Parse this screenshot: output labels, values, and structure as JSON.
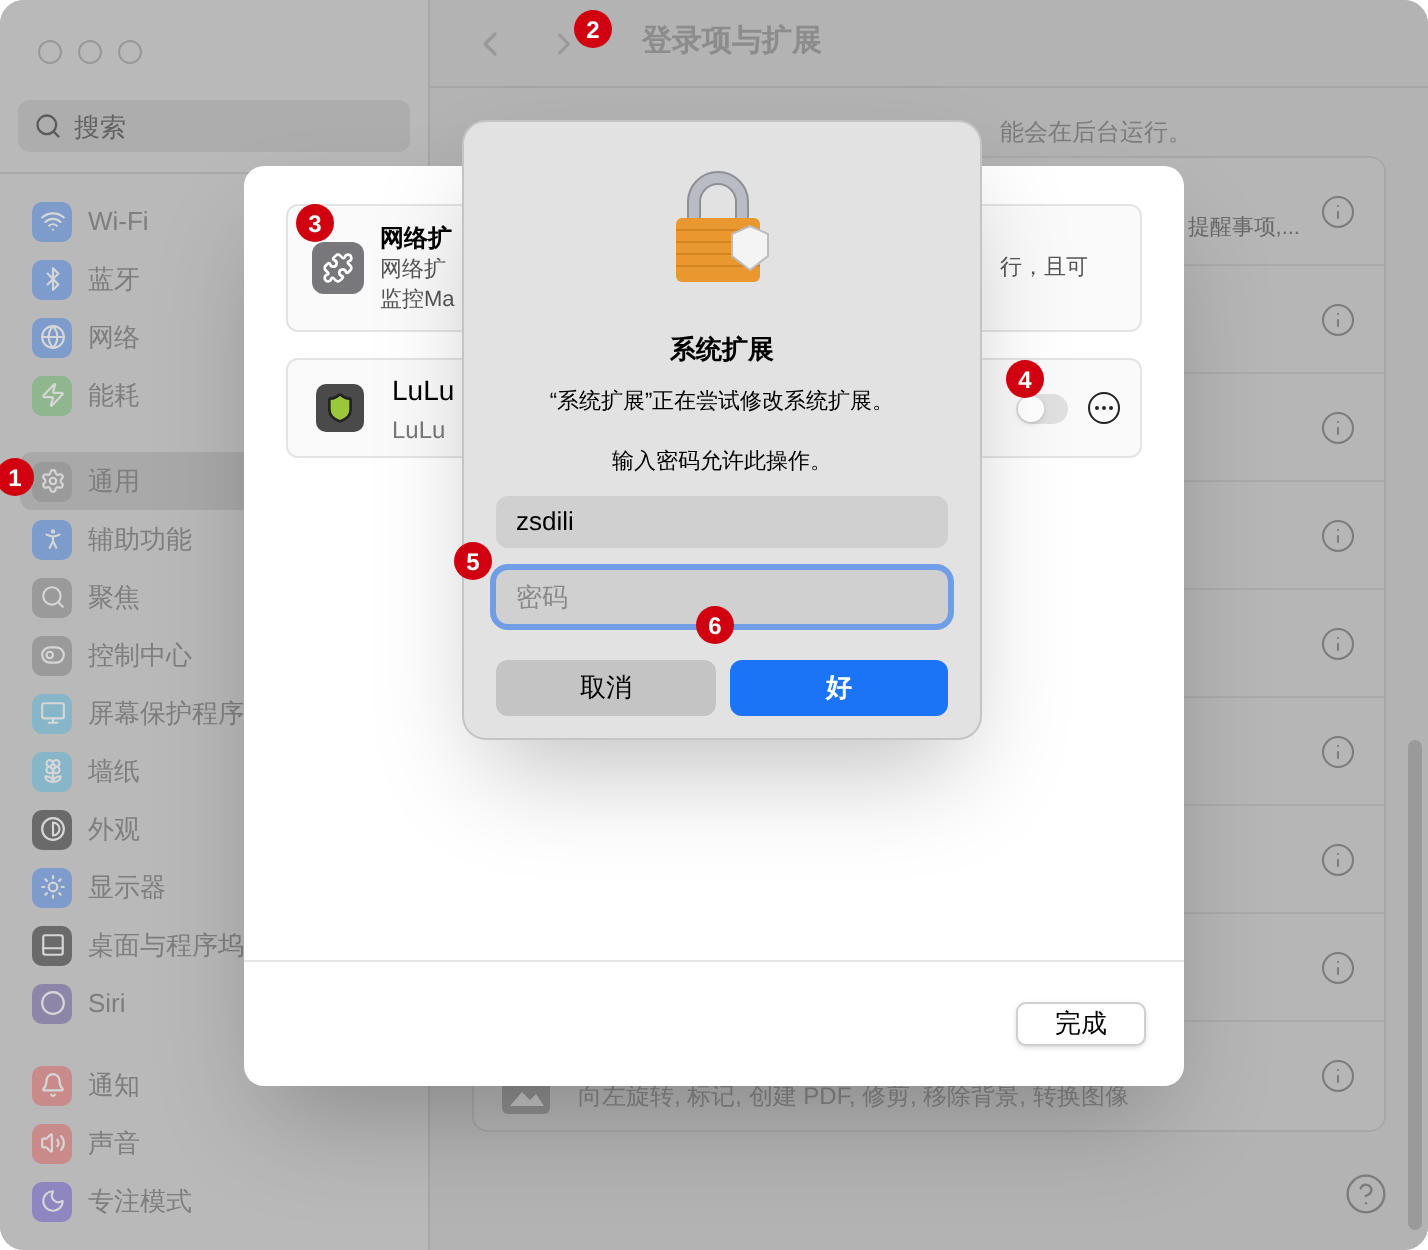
{
  "sidebar": {
    "search": {
      "placeholder": "搜索"
    },
    "groups": [
      [
        {
          "label": "Wi-Fi",
          "color": "#7d9ccb",
          "selected": false
        },
        {
          "label": "蓝牙",
          "color": "#7d9ccb",
          "selected": false
        },
        {
          "label": "网络",
          "color": "#7d9ccb",
          "selected": false
        },
        {
          "label": "能耗",
          "color": "#8fb68c",
          "selected": false
        }
      ],
      [
        {
          "label": "通用",
          "color": "#9a9a9a",
          "selected": true
        },
        {
          "label": "辅助功能",
          "color": "#7d9ccb",
          "selected": false
        },
        {
          "label": "聚焦",
          "color": "#9a9a9a",
          "selected": false
        },
        {
          "label": "控制中心",
          "color": "#9a9a9a",
          "selected": false
        },
        {
          "label": "屏幕保护程序",
          "color": "#86b6c8",
          "selected": false
        },
        {
          "label": "墙纸",
          "color": "#86b6c8",
          "selected": false
        },
        {
          "label": "外观",
          "color": "#6a6a6a",
          "selected": false
        },
        {
          "label": "显示器",
          "color": "#7d9ccb",
          "selected": false
        },
        {
          "label": "桌面与程序坞",
          "color": "#6a6a6a",
          "selected": false
        },
        {
          "label": "Siri",
          "color": "#8e86a8",
          "selected": false
        }
      ],
      [
        {
          "label": "通知",
          "color": "#c98a8a",
          "selected": false
        },
        {
          "label": "声音",
          "color": "#c98a8a",
          "selected": false
        },
        {
          "label": "专注模式",
          "color": "#8e86c0",
          "selected": false
        }
      ]
    ]
  },
  "header": {
    "title": "登录项与扩展"
  },
  "content": {
    "description": "能会在后台运行。",
    "rows": [
      {
        "kind": "text",
        "text": "提醒事项,..."
      },
      {
        "kind": "blank"
      },
      {
        "kind": "blank"
      },
      {
        "kind": "blank"
      },
      {
        "kind": "blank"
      },
      {
        "kind": "blank"
      },
      {
        "kind": "blank"
      },
      {
        "kind": "blank"
      },
      {
        "kind": "app",
        "text": "向左旋转, 标记, 创建 PDF, 修剪, 移除背景, 转换图像"
      }
    ]
  },
  "sheet": {
    "extensions": [
      {
        "kind": "network",
        "title": "网络扩",
        "lines": [
          "网络扩",
          "监控Ma"
        ],
        "trailing": "行，且可"
      },
      {
        "kind": "app",
        "title": "LuLu",
        "subtitle": "LuLu",
        "on": false
      }
    ],
    "done": "完成"
  },
  "dialog": {
    "title": "系统扩展",
    "message": "“系统扩展”正在尝试修改系统扩展。",
    "prompt": "输入密码允许此操作。",
    "username": "zsdili",
    "password": {
      "placeholder": "密码",
      "focused": true
    },
    "buttons": [
      {
        "label": "取消",
        "kind": "cancel"
      },
      {
        "label": "好",
        "kind": "default"
      }
    ]
  },
  "annotations": [
    {
      "label": "1"
    },
    {
      "label": "2"
    },
    {
      "label": "3"
    },
    {
      "label": "4"
    },
    {
      "label": "5"
    },
    {
      "label": "6"
    }
  ]
}
